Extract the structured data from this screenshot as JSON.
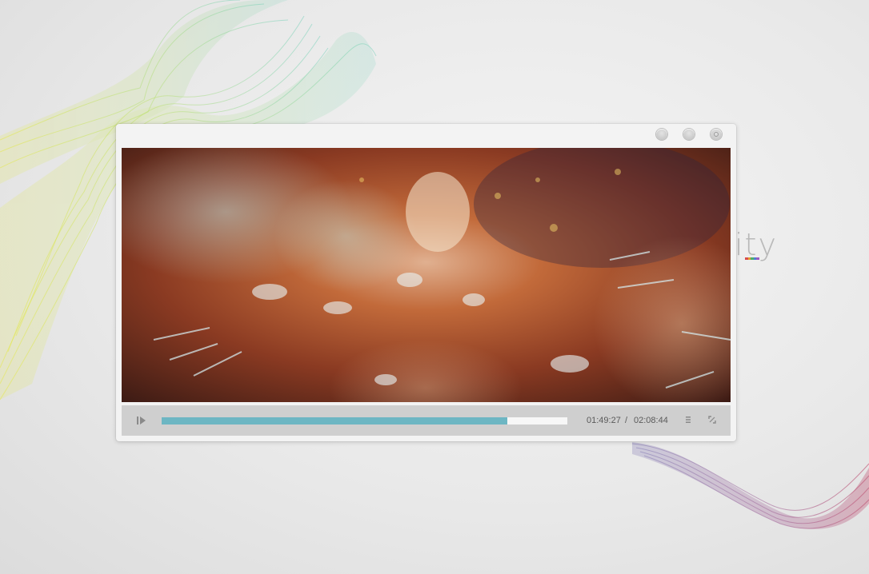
{
  "desktop": {
    "brand_text": "ity",
    "brand_bar_colors": [
      "#d94c4c",
      "#e0a030",
      "#4cae6a",
      "#4a7fd0",
      "#9a5bc0"
    ]
  },
  "window": {
    "controls": [
      "minimize-icon",
      "maximize-icon",
      "close-icon"
    ]
  },
  "player": {
    "progress_fraction": 0.853,
    "progress_color": "#6db6c3",
    "current_time": "01:49:27",
    "separator": "/",
    "total_time": "02:08:44",
    "icons": {
      "play": "play-pause-icon",
      "playlist": "playlist-icon",
      "fullscreen": "fullscreen-icon"
    }
  }
}
